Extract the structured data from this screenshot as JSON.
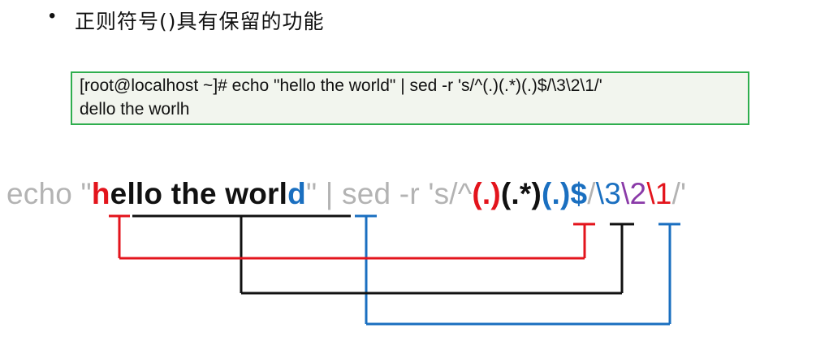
{
  "heading": {
    "bullet": "•",
    "text": "正则符号()具有保留的功能"
  },
  "terminal": {
    "line1": "[root@localhost ~]# echo \"hello the world\" | sed -r 's/^(.)(.*)(.)$/\\3\\2\\1/'",
    "line2": "dello the worlh"
  },
  "command": {
    "prefix": "echo \"",
    "first_char": "h",
    "middle": "ello the worl",
    "last_char": "d",
    "pipe_part": "\" | sed -r 's/^",
    "group1": "(.)",
    "group2": "(.*)",
    "group3": "(.)",
    "dollar": "$",
    "slash": "/",
    "ref3": "\\3",
    "ref2": "\\2",
    "ref1": "\\1",
    "tail": "/'"
  },
  "colors": {
    "group1": "#e3141c",
    "group2": "#111111",
    "group3": "#1a6fc0",
    "ref2": "#8a3aa8",
    "muted": "#b3b3b3",
    "box_border": "#2fae4e"
  }
}
